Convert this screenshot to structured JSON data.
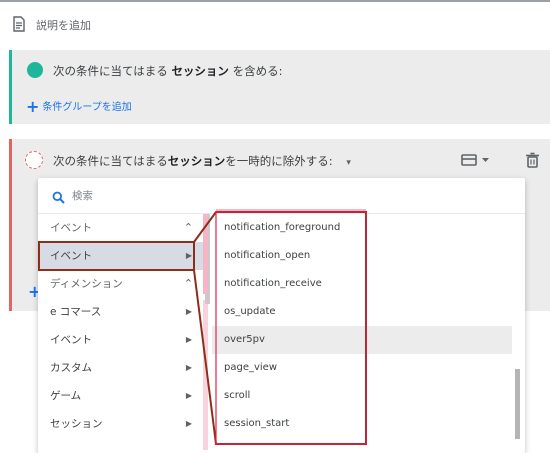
{
  "description": {
    "label": "説明を追加",
    "icon": "document-icon"
  },
  "include_group": {
    "text_prefix": "次の条件に当てはまる",
    "bold": "セッション",
    "text_suffix": "を含める:",
    "add_group_label": "条件グループを追加",
    "accent_color": "#1fb59b"
  },
  "exclude_group": {
    "text_prefix": "次の条件に当てはまる",
    "bold": "セッション",
    "text_suffix": "を一時的に除外する:",
    "caret": "▾",
    "accent_color": "#e06666",
    "icons": [
      "layout-menu-icon",
      "chevron-down-icon",
      "trash-icon"
    ]
  },
  "dropdown": {
    "search_placeholder": "検索",
    "categories": [
      {
        "label": "イベント",
        "type": "header",
        "chevron": "⌃"
      },
      {
        "label": "イベント",
        "type": "selected",
        "arrow": "▶"
      },
      {
        "label": "ディメンション",
        "type": "header",
        "chevron": "⌃"
      },
      {
        "label": "e コマース",
        "arrow": "▶"
      },
      {
        "label": "イベント",
        "arrow": "▶"
      },
      {
        "label": "カスタム",
        "arrow": "▶"
      },
      {
        "label": "ゲーム",
        "arrow": "▶"
      },
      {
        "label": "セッション",
        "arrow": "▶"
      }
    ],
    "events": [
      "notification_foreground",
      "notification_open",
      "notification_receive",
      "os_update",
      "over5pv",
      "page_view",
      "scroll",
      "session_start"
    ],
    "hovered_event": "over5pv"
  },
  "annotation_colors": {
    "frame": "#8b2f1a",
    "highlight": "#e0244a"
  }
}
